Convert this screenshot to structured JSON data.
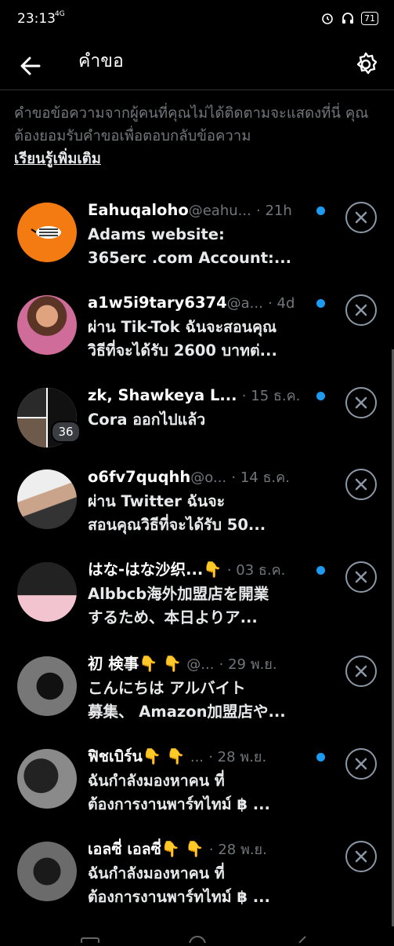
{
  "status": {
    "time": "23:13",
    "network": "4G",
    "battery": "71"
  },
  "header": {
    "title": "คำขอ"
  },
  "notice": {
    "text": "คำขอข้อความจากผู้คนที่คุณไม่ได้ติดตามจะแสดงที่นี่ คุณต้องยอมรับคำขอเพื่อตอบกลับข้อความ",
    "learn_more": "เรียนรู้เพิ่มเติม"
  },
  "requests": [
    {
      "sender": "Eahuqaloho",
      "handle": "@eahu...",
      "time": "· 21h",
      "preview": "Adams website:\n365erc .com Account:..."
    },
    {
      "sender": "a1w5i9tary6374",
      "handle": "@a...",
      "time": "· 4d",
      "preview": "ผ่าน Tik-Tok ฉันจะสอนคุณ\nวิธีที่จะได้รับ 2600 บาทต่..."
    },
    {
      "sender": "zk, Shawkeya L...",
      "handle": "",
      "time": "· 15 ธ.ค.",
      "preview": "Cora ออกไปแล้ว",
      "badge": "36"
    },
    {
      "sender": "o6fv7quqhh",
      "handle": "@o...",
      "time": "· 14 ธ.ค.",
      "preview": "ผ่าน Twitter ฉันจะ\nสอนคุณวิธีที่จะได้รับ 50..."
    },
    {
      "sender": "はな-はな沙织...",
      "handle": "",
      "time": "· 03 ธ.ค.",
      "preview": "Albbcb海外加盟店を開業\nするため、本日よりア...",
      "emoji": "👇"
    },
    {
      "sender": "初 検事",
      "handle": "@...",
      "time": "· 29 พ.ย.",
      "preview": "こんにちは アルバイト\n募集、 Amazon加盟店や...",
      "emoji": "👇 👇"
    },
    {
      "sender": "ฟิชเบิร์น",
      "handle": "...",
      "time": "· 28 พ.ย.",
      "preview": "ฉันกำลังมองหาคน ที่\nต้องการงานพาร์ทไทม์ ฿ ...",
      "emoji": "👇 👇"
    },
    {
      "sender": "เอลซี่ เอลซี่",
      "handle": "",
      "time": "· 28 พ.ย.",
      "preview": "ฉันกำลังมองหาคน ที่\nต้องการงานพาร์ทไทม์ ฿ ...",
      "emoji": "👇 👇"
    }
  ],
  "colors": {
    "accent": "#1d9bf0",
    "muted": "#71767b",
    "background": "#000000"
  }
}
